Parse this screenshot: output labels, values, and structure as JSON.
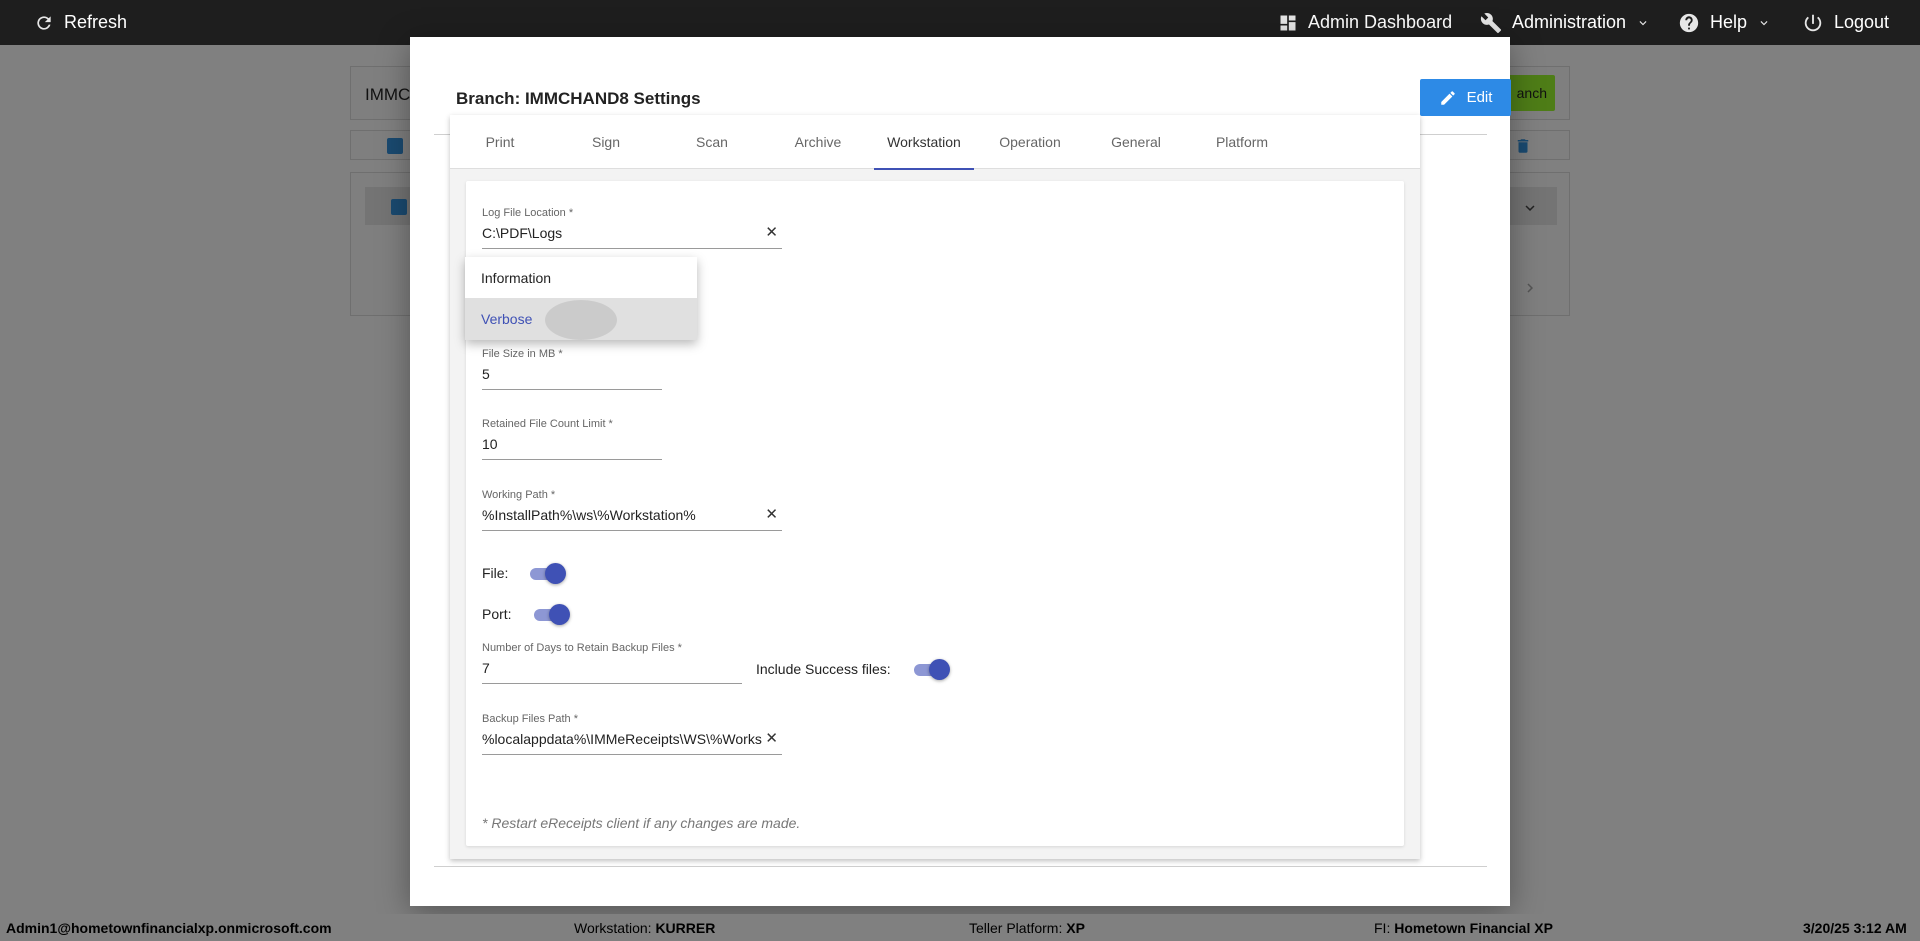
{
  "topbar": {
    "refresh_label": "Refresh",
    "admin_dashboard_label": "Admin Dashboard",
    "administration_label": "Administration",
    "help_label": "Help",
    "logout_label": "Logout"
  },
  "background": {
    "branch_input_partial": "IMMC",
    "add_branch_partial": "anch"
  },
  "modal": {
    "title": "Branch: IMMCHAND8 Settings",
    "edit_label": "Edit",
    "tabs": [
      {
        "label": "Print"
      },
      {
        "label": "Sign"
      },
      {
        "label": "Scan"
      },
      {
        "label": "Archive"
      },
      {
        "label": "Workstation"
      },
      {
        "label": "Operation"
      },
      {
        "label": "General"
      },
      {
        "label": "Platform"
      }
    ],
    "active_tab": "Workstation",
    "fields": {
      "log_file_location": {
        "label": "Log File Location *",
        "value": "C:\\PDF\\Logs"
      },
      "file_size": {
        "label": "File Size in MB *",
        "value": "5"
      },
      "retained_count": {
        "label": "Retained File Count Limit *",
        "value": "10"
      },
      "working_path": {
        "label": "Working Path *",
        "value": "%InstallPath%\\ws\\%Workstation%"
      },
      "file_toggle": {
        "label": "File:",
        "on": true
      },
      "port_toggle": {
        "label": "Port:",
        "on": true
      },
      "backup_days": {
        "label": "Number of Days to Retain Backup Files *",
        "value": "7"
      },
      "include_success": {
        "label": "Include Success files:",
        "on": true
      },
      "backup_path": {
        "label": "Backup Files Path *",
        "value": "%localappdata%\\IMMeReceipts\\WS\\%Works"
      }
    },
    "note": "* Restart eReceipts client if any changes are made.",
    "log_level_dropdown": {
      "options": [
        "Information",
        "Verbose"
      ],
      "selected": "Verbose"
    }
  },
  "statusbar": {
    "user": "Admin1@hometownfinancialxp.onmicrosoft.com",
    "workstation_label": "Workstation:",
    "workstation_value": "KURRER",
    "platform_label": "Teller Platform:",
    "platform_value": "XP",
    "fi_label": "FI:",
    "fi_value": "Hometown Financial XP",
    "datetime": "3/20/25 3:12 AM"
  },
  "colors": {
    "accent": "#3f51b5",
    "edit_button": "#2d8ae6",
    "topbar": "#1e1e1e",
    "overlay": "#808080"
  }
}
